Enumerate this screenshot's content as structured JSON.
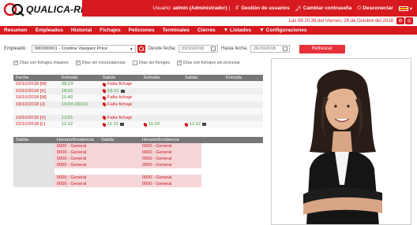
{
  "app": {
    "logo_text": "QUALICA-RD"
  },
  "topnav": {
    "user_label": "Usuario:",
    "user_name": "admin (Administrador)",
    "separator": "|",
    "gestion_label": "Gestión de usuarios",
    "cambiar_label": "Cambiar contraseña",
    "desconectar_label": "Desconectar"
  },
  "datebar": {
    "text": "Las 08:20:38 del Viernes, 26 de Octubre del 2018"
  },
  "menu": [
    "Resumen",
    "Empleados",
    "Historial",
    "Fichajes",
    "Peticiones",
    "Terminales",
    "Cierres",
    "▼ Listados",
    "▼ Configuraciones"
  ],
  "filters": {
    "empleado_label": "Empleado:",
    "empleado_value": "000000001 - Cristina Vasquez Price",
    "desde_label": "Desde fecha:",
    "desde_value": "03/10/2018",
    "hasta_label": "Hasta fecha:",
    "hasta_value": "26/10/2018",
    "refresh_label": "Refrescar"
  },
  "checks": [
    {
      "label": "Días con fichajes impares",
      "checked": true
    },
    {
      "label": "Días sin circunstancias",
      "checked": true
    },
    {
      "label": "Días sin fichajes",
      "checked": false
    },
    {
      "label": "Días con fichajes sin procesar",
      "checked": true
    }
  ],
  "table1": {
    "headers": [
      "Fecha",
      "Entrada",
      "Salida",
      "Entrada",
      "Salida",
      "Entrada"
    ],
    "rows": [
      {
        "fecha": "02/10/2018 [M]",
        "entrada": "08:23",
        "salida": "Falta fichaje",
        "entrada2": "",
        "salida2": "",
        "entrada3": ""
      },
      {
        "fecha": "10/10/2018 [X]",
        "entrada": "18:21",
        "salida": "16:21",
        "entrada2": "",
        "salida2": "",
        "entrada3": ""
      },
      {
        "fecha": "16/10/2018 [M]",
        "entrada": "11:40",
        "salida": "Falta fichaje",
        "entrada2": "",
        "salida2": "",
        "entrada3": ""
      },
      {
        "fecha": "18/10/2018 [J]",
        "entrada": "19:04 (0010)",
        "salida": "Falta fichaje",
        "entrada2": "",
        "salida2": "",
        "entrada3": ""
      },
      {
        "fecha": "",
        "entrada": "",
        "salida": "",
        "entrada2": "",
        "salida2": "",
        "entrada3": ""
      },
      {
        "fecha": "19/10/2018 [V]",
        "entrada": "13:01",
        "salida": "Falta fichaje",
        "entrada2": "",
        "salida2": "",
        "entrada3": ""
      },
      {
        "fecha": "22/10/2018 [L]",
        "entrada": "11:12",
        "salida": "11:12",
        "entrada2": "11:20",
        "salida2": "11:22",
        "entrada3": ""
      }
    ]
  },
  "table2": {
    "headers": [
      "Salida",
      "Horario/Incidencia",
      "Salida",
      "Horario/Incidencia",
      ""
    ],
    "rows": [
      {
        "a": "0000 - General",
        "b": "0000 - General"
      },
      {
        "a": "0000 - General",
        "b": "0000 - General"
      },
      {
        "a": "0000 - General",
        "b": "0000 - General"
      },
      {
        "a": "0000 - General",
        "b": "0000 - General"
      },
      {
        "a": "",
        "b": ""
      },
      {
        "a": "0000 - General",
        "b": "0000 - General"
      },
      {
        "a": "0000 - General",
        "b": "0000 - General"
      }
    ]
  },
  "colors": {
    "brand_red": "#d71920",
    "header_grey": "#777777",
    "incident_pink": "#f6d5d7"
  }
}
